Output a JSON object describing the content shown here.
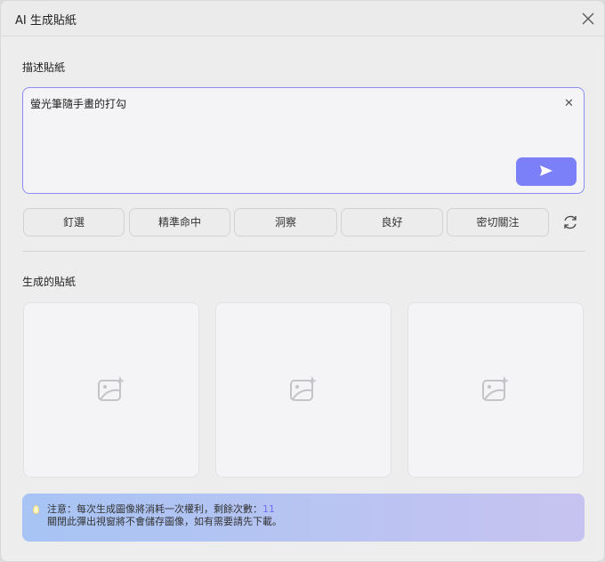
{
  "dialog": {
    "title": "AI 生成貼紙"
  },
  "describe": {
    "label": "描述貼紙",
    "value": "螢光筆隨手畫的打勾"
  },
  "chips": [
    "釘選",
    "精準命中",
    "洞察",
    "良好",
    "密切關注"
  ],
  "generated": {
    "label": "生成的貼紙",
    "card_count": 3
  },
  "notice": {
    "line1": "注意：每次生成圖像將消耗一次權利，剩餘次數：",
    "remaining": "11",
    "line2": "關閉此彈出視窗將不會儲存圖像，如有需要請先下載。"
  },
  "colors": {
    "accent": "#7b7ff8"
  }
}
